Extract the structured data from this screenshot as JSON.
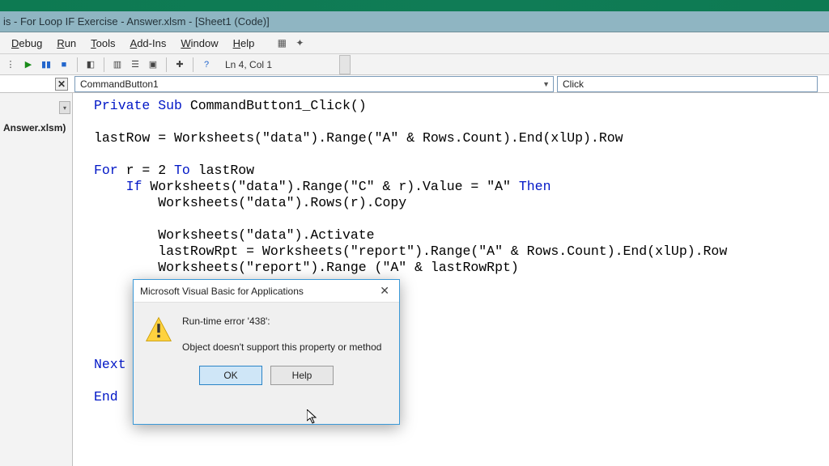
{
  "title": "is - For Loop IF Exercise - Answer.xlsm - [Sheet1 (Code)]",
  "menu": {
    "debug": "Debug",
    "run": "Run",
    "tools": "Tools",
    "addins": "Add-Ins",
    "window": "Window",
    "help": "Help"
  },
  "toolbar": {
    "status": "Ln 4, Col 1"
  },
  "project": {
    "file": "Answer.xlsm)"
  },
  "dropdowns": {
    "object": "CommandButton1",
    "proc": "Click"
  },
  "code": {
    "l1a": "Private",
    "l1b": "Sub",
    "l1c": " CommandButton1_Click()",
    "l3a": "lastRow = Worksheets(",
    "l3b": "\"data\"",
    "l3c": ").Range(",
    "l3d": "\"A\"",
    "l3e": " & Rows.Count).End(xlUp).Row",
    "l5a": "For",
    "l5b": " r = 2 ",
    "l5c": "To",
    "l5d": " lastRow",
    "l6a": "    ",
    "l6b": "If",
    "l6c": " Worksheets(",
    "l6d": "\"data\"",
    "l6e": ").Range(",
    "l6f": "\"C\"",
    "l6g": " & r).Value = ",
    "l6h": "\"A\"",
    "l6i": " ",
    "l6j": "Then",
    "l7": "        Worksheets(\"data\").Rows(r).Copy",
    "l9": "        Worksheets(\"data\").Activate",
    "l10": "        lastRowRpt = Worksheets(\"report\").Range(\"A\" & Rows.Count).End(xlUp).Row",
    "l11": "        Worksheets(\"report\").Range (\"A\" & lastRowRpt)",
    "l17": "Next",
    "l19a": "End",
    "l19b": " "
  },
  "dialog": {
    "title": "Microsoft Visual Basic for Applications",
    "line1": "Run-time error '438':",
    "line2": "Object doesn't support this property or method",
    "ok": "OK",
    "help": "Help"
  }
}
